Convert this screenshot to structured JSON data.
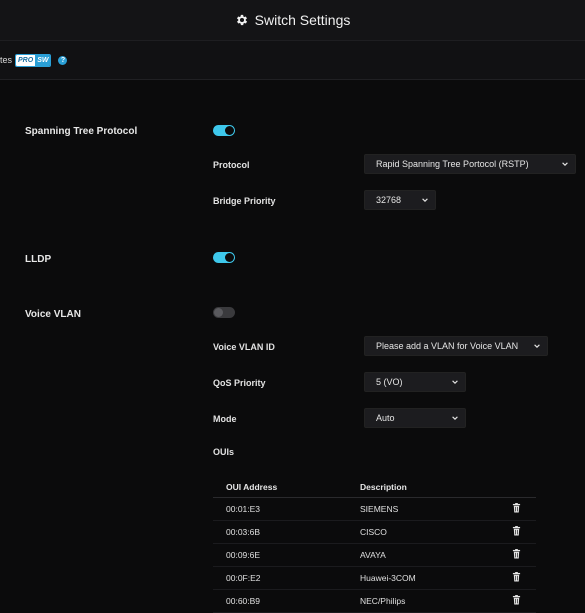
{
  "header": {
    "title": "Switch Settings",
    "icon": "gear-icon"
  },
  "subbar": {
    "crumb": "tes",
    "badge_pro": "PRO",
    "badge_sw": "SW",
    "help_icon": "help-icon",
    "help_glyph": "?"
  },
  "stp": {
    "label": "Spanning Tree Protocol",
    "enabled": true,
    "protocol_label": "Protocol",
    "protocol_value": "Rapid Spanning Tree Portocol (RSTP)",
    "bridge_label": "Bridge Priority",
    "bridge_value": "32768"
  },
  "lldp": {
    "label": "LLDP",
    "enabled": true
  },
  "voice": {
    "label": "Voice VLAN",
    "enabled": false,
    "vlan_id_label": "Voice VLAN ID",
    "vlan_id_value": "Please add a VLAN for Voice VLAN",
    "qos_label": "QoS Priority",
    "qos_value": "5 (VO)",
    "mode_label": "Mode",
    "mode_value": "Auto",
    "ouis_label": "OUIs"
  },
  "oui_table": {
    "headers": [
      "OUI Address",
      "Description"
    ],
    "rows": [
      {
        "address": "00:01:E3",
        "description": "SIEMENS"
      },
      {
        "address": "00:03:6B",
        "description": "CISCO"
      },
      {
        "address": "00:09:6E",
        "description": "AVAYA"
      },
      {
        "address": "00:0F:E2",
        "description": "Huawei-3COM"
      },
      {
        "address": "00:60:B9",
        "description": "NEC/Philips"
      }
    ]
  },
  "colors": {
    "accent": "#3ec8ec",
    "background": "#0b0b0c"
  }
}
